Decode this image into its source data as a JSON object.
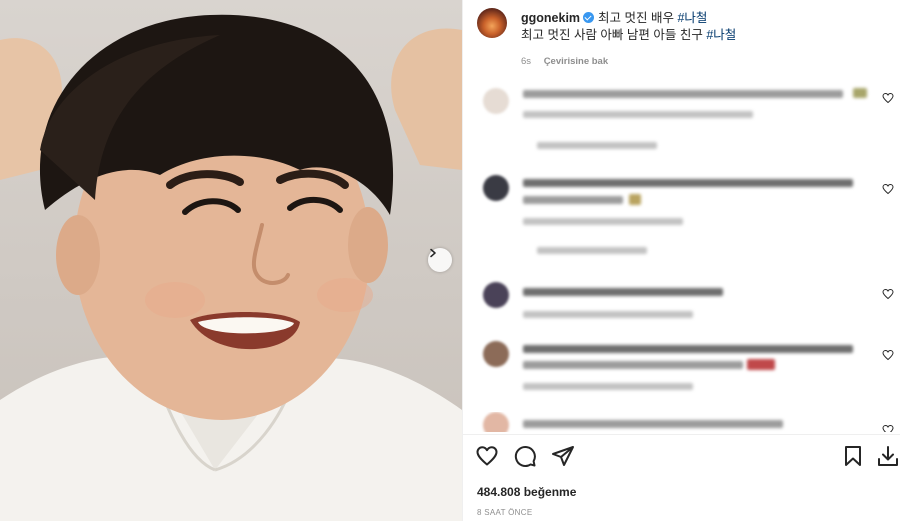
{
  "post": {
    "username": "ggonekim",
    "caption_text": "최고 멋진 배우",
    "caption_tag1": "#나철",
    "caption_line2": "최고 멋진 사람 아빠 남편 아들 친구",
    "caption_tag2": "#나철",
    "age": "6s",
    "see_translation": "Çevirisine bak",
    "likes": "484.808 beğenme",
    "timestamp": "8 SAAT ÖNCE"
  },
  "icons": {
    "next": "chevron-right-icon",
    "like": "heart-icon",
    "comment": "comment-bubble-icon",
    "share": "paper-plane-icon",
    "save": "bookmark-icon",
    "download": "download-icon"
  },
  "colors": {
    "verified": "#3897f0",
    "hashtag": "#00376b",
    "muted": "#8e8e8e"
  }
}
